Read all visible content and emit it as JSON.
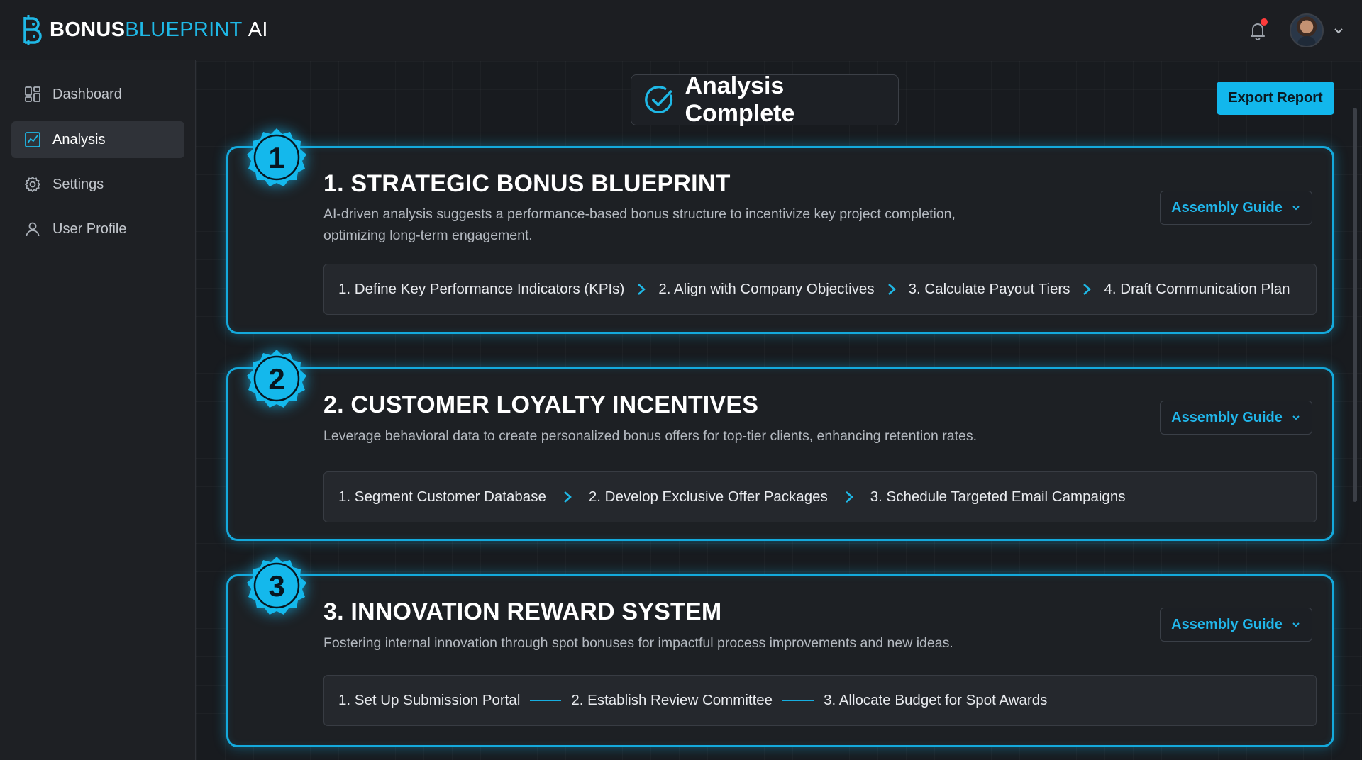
{
  "brand": {
    "bonus": "BONUS",
    "blueprint": "BLUEPRINT",
    "ai": "AI"
  },
  "topbar": {
    "notification_dot_color": "#ff3b3b",
    "bell_icon": "bell-icon",
    "avatar_icon": "user-avatar"
  },
  "sidebar": {
    "items": [
      {
        "label": "Dashboard",
        "icon": "grid-icon",
        "active": false
      },
      {
        "label": "Analysis",
        "icon": "chart-icon",
        "active": true
      },
      {
        "label": "Settings",
        "icon": "gear-icon",
        "active": false
      },
      {
        "label": "User Profile",
        "icon": "user-icon",
        "active": false
      }
    ]
  },
  "main": {
    "status_title": "Analysis Complete",
    "export_label": "Export Report",
    "accent_color": "#14a9dc",
    "cards": [
      {
        "number": "1",
        "title": "1. STRATEGIC BONUS BLUEPRINT",
        "description": "AI-driven analysis suggests a performance-based bonus structure to incentivize key project completion, optimizing long-term engagement.",
        "guide_label": "Assembly Guide",
        "separator": "chevron",
        "steps": [
          "1. Define Key Performance Indicators (KPIs)",
          "2. Align with Company Objectives",
          "3. Calculate Payout Tiers",
          "4. Draft Communication Plan"
        ]
      },
      {
        "number": "2",
        "title": "2. CUSTOMER LOYALTY INCENTIVES",
        "description": "Leverage behavioral data to create personalized bonus offers for top-tier clients, enhancing retention rates.",
        "guide_label": "Assembly Guide",
        "separator": "chevron",
        "steps": [
          "1. Segment Customer Database",
          "2. Develop Exclusive Offer Packages",
          "3. Schedule Targeted Email Campaigns"
        ]
      },
      {
        "number": "3",
        "title": "3. INNOVATION REWARD SYSTEM",
        "description": "Fostering internal innovation through spot bonuses for impactful process improvements and new ideas.",
        "guide_label": "Assembly Guide",
        "separator": "line",
        "steps": [
          "1. Set Up Submission Portal",
          "2. Establish Review Committee",
          "3. Allocate Budget for Spot Awards"
        ]
      }
    ]
  }
}
